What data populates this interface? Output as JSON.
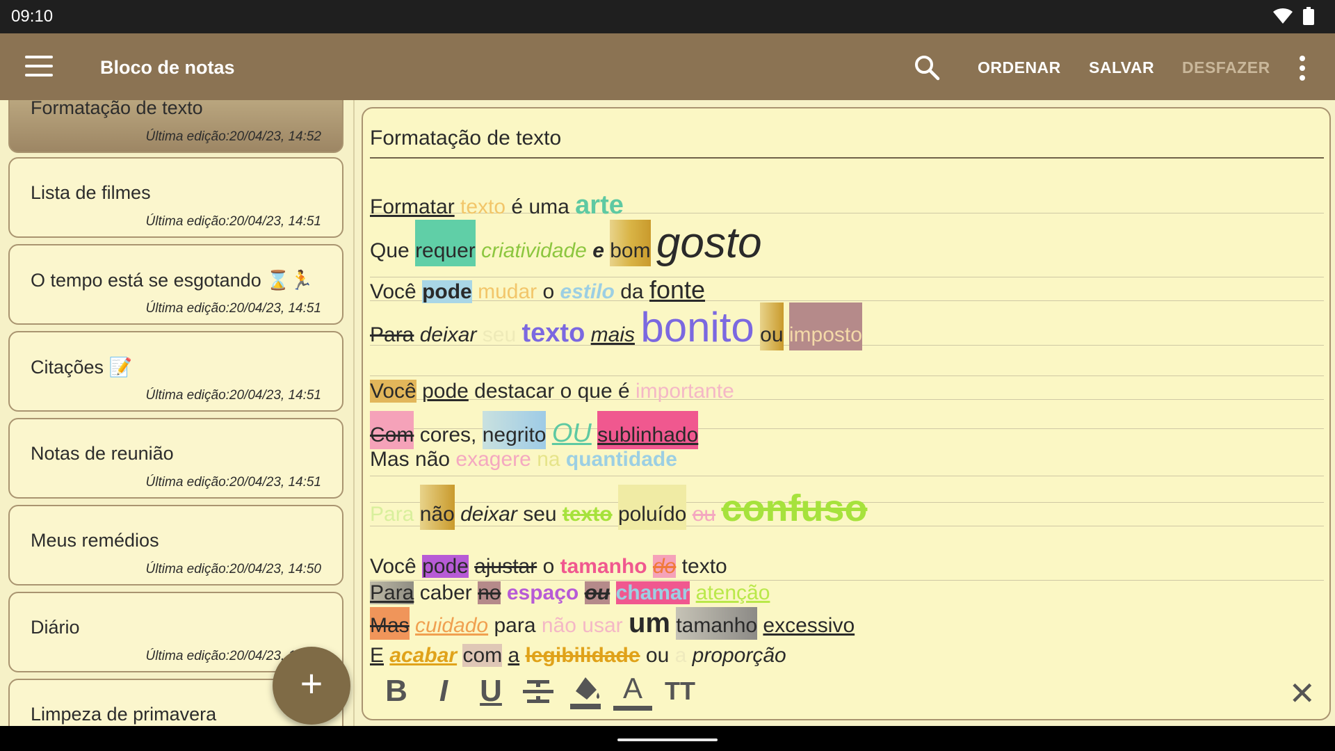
{
  "status": {
    "time": "09:10"
  },
  "app_bar": {
    "title": "Bloco de notas",
    "actions": {
      "sort": "ORDENAR",
      "save": "SALVAR",
      "undo": "DESFAZER"
    }
  },
  "notes": [
    {
      "title": "Formatação de texto",
      "date": "Última edição:20/04/23, 14:52"
    },
    {
      "title": "Lista de filmes",
      "date": "Última edição:20/04/23, 14:51"
    },
    {
      "title": "O tempo está se esgotando ⌛🏃",
      "date": "Última edição:20/04/23, 14:51"
    },
    {
      "title": "Citações 📝",
      "date": "Última edição:20/04/23, 14:51"
    },
    {
      "title": "Notas de reunião",
      "date": "Última edição:20/04/23, 14:51"
    },
    {
      "title": "Meus remédios",
      "date": "Última edição:20/04/23, 14:50"
    },
    {
      "title": "Diário",
      "date": "Última edição:20/04/23, 14:50"
    },
    {
      "title": "Limpeza de primavera",
      "date": ""
    }
  ],
  "fab": {
    "label": "+"
  },
  "editor": {
    "title": "Formatação de texto",
    "w": {
      "l1": [
        "Formatar",
        "texto",
        "é uma",
        "arte"
      ],
      "l2": [
        "Que",
        "requer",
        "criatividade",
        "e",
        "bom",
        "gosto"
      ],
      "l3": [
        "Você",
        "pode",
        "mudar",
        "o",
        "estilo",
        "da",
        "fonte"
      ],
      "l4": [
        "Para",
        "deixar",
        "seu",
        "texto",
        "mais",
        "bonito",
        "ou",
        "imposto"
      ],
      "l5": [
        "Você",
        "pode",
        "destacar o que é",
        "importante"
      ],
      "l6": [
        "Com",
        "cores,",
        "negrito",
        "OU",
        "sublinhado"
      ],
      "l7": [
        "Mas não",
        "exagere",
        "na",
        "quantidade"
      ],
      "l8": [
        "Para",
        "não",
        "deixar",
        "seu",
        "texto",
        "poluído",
        "ou",
        "confuso"
      ],
      "l9": [
        "Você",
        "pode",
        "ajustar",
        "o",
        "tamanho",
        "do",
        "texto"
      ],
      "l10": [
        "Para",
        "caber",
        "no",
        "espaço",
        "ou",
        "chamar",
        "atenção"
      ],
      "l11": [
        "Mas",
        "cuidado",
        "para",
        "não",
        "usar",
        "um",
        "tamanho",
        "excessivo"
      ],
      "l12": [
        "E",
        "acabar",
        "com",
        "a",
        "legibilidade",
        "ou",
        "a",
        "proporção"
      ]
    },
    "toolbar": {
      "bold": "B",
      "italic": "I",
      "underline": "U",
      "strike": "S",
      "text_color": "A",
      "size": "TT"
    }
  },
  "colors": {
    "app_bar": "#8b7353",
    "fab": "#7f6b46",
    "paper": "#fbf7c4"
  }
}
